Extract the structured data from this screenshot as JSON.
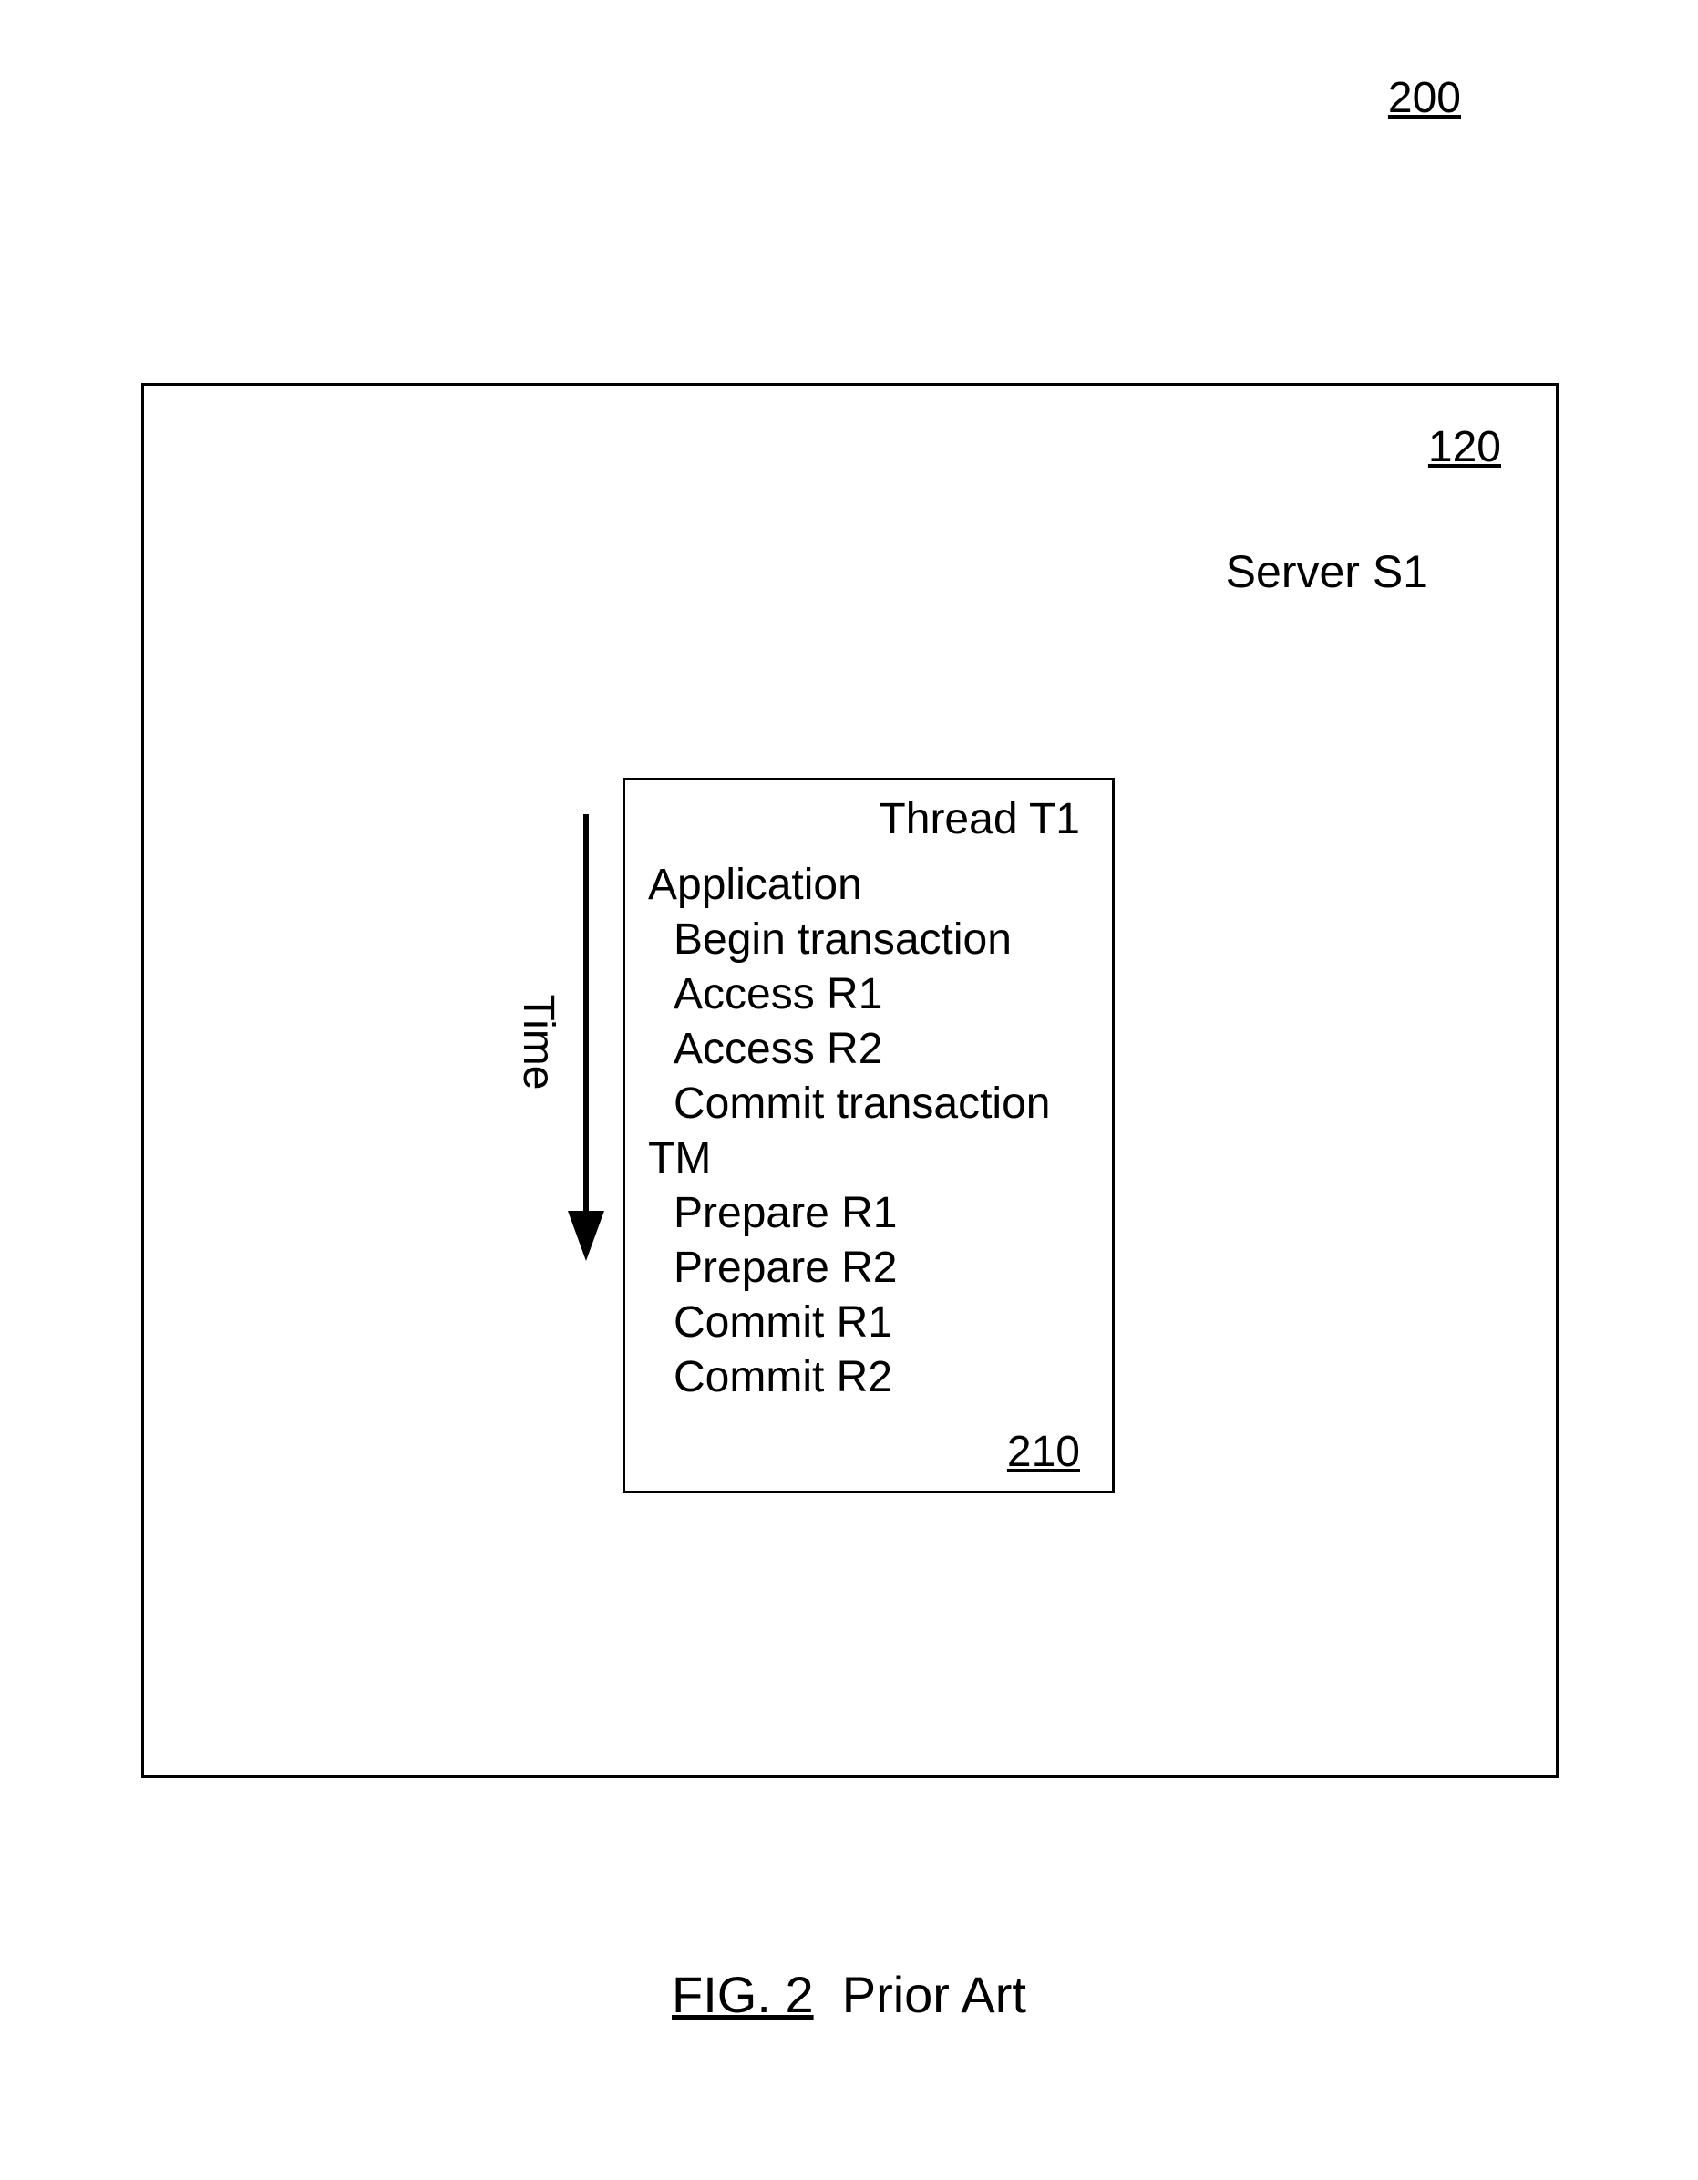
{
  "page": {
    "ref": "200"
  },
  "outer": {
    "ref": "120",
    "serverLabel": "Server S1"
  },
  "thread": {
    "title": "Thread T1",
    "ref": "210",
    "groupA": "Application",
    "stepA1": "Begin transaction",
    "stepA2": "Access R1",
    "stepA3": "Access R2",
    "stepA4": "Commit transaction",
    "groupB": "TM",
    "stepB1": "Prepare R1",
    "stepB2": "Prepare R2",
    "stepB3": "Commit R1",
    "stepB4": "Commit R2"
  },
  "timeAxis": {
    "label": "Time"
  },
  "caption": {
    "figNum": "FIG. 2",
    "figText": "Prior Art"
  }
}
